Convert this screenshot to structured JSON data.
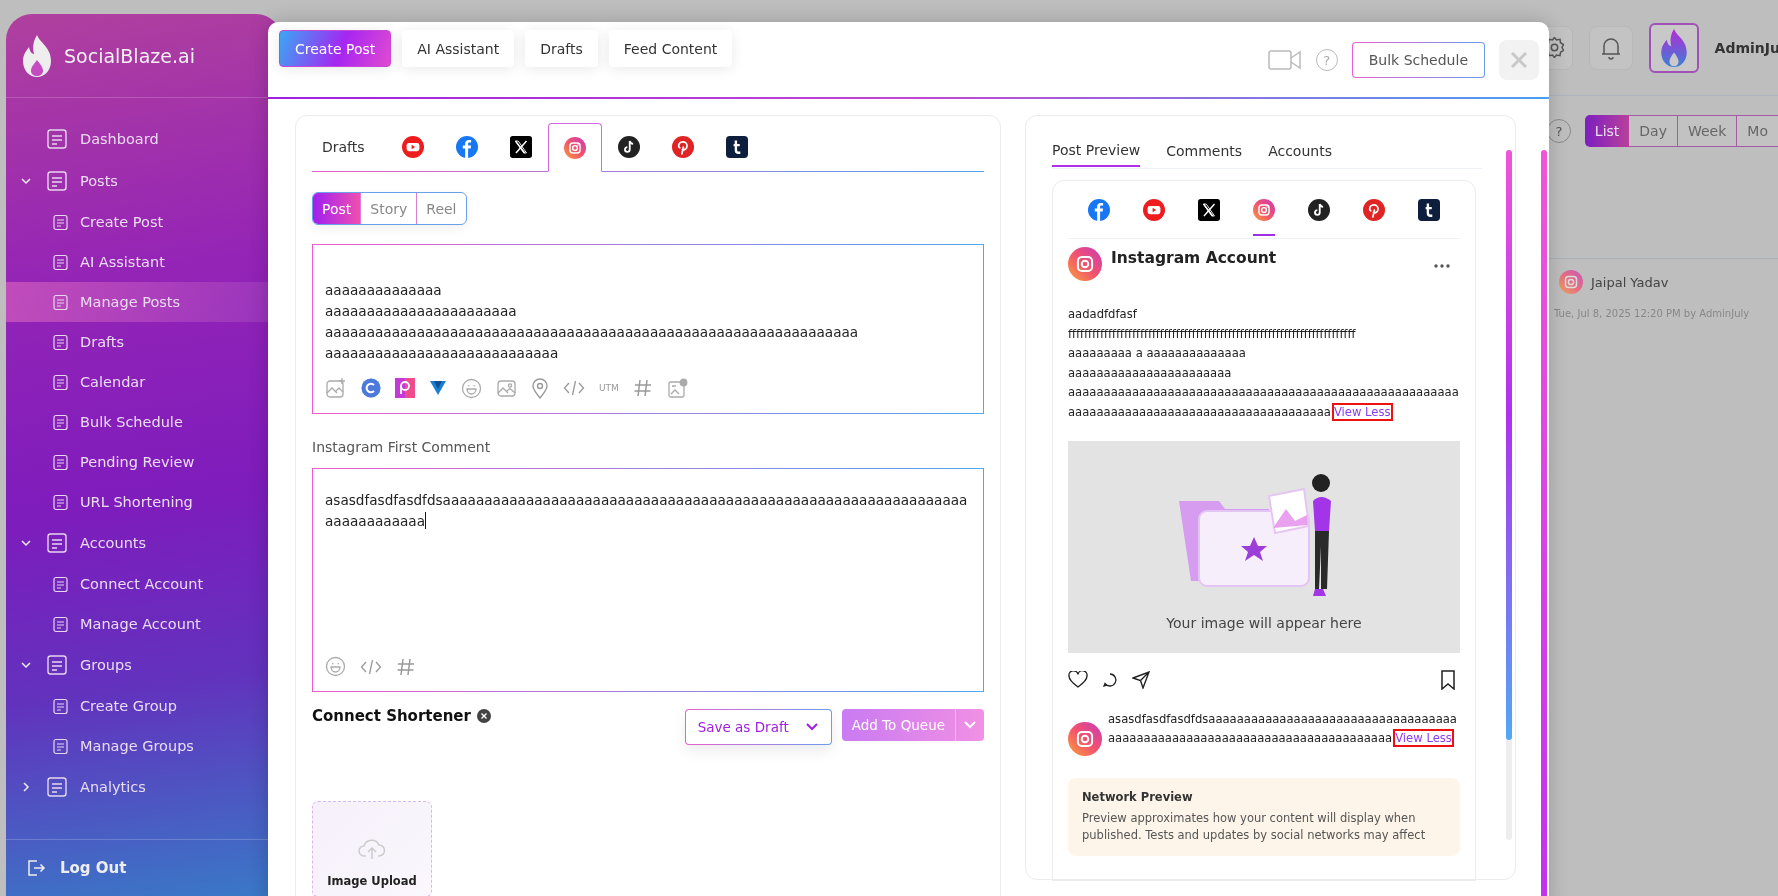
{
  "sidebar": {
    "brand": "SocialBlaze.ai",
    "items": [
      {
        "label": "Dashboard",
        "selected": false
      },
      {
        "label": "Posts",
        "selected": false,
        "expanded": true,
        "children": [
          {
            "label": "Create Post",
            "selected": false
          },
          {
            "label": "AI Assistant",
            "selected": false
          },
          {
            "label": "Manage Posts",
            "selected": true
          },
          {
            "label": "Drafts",
            "selected": false
          },
          {
            "label": "Calendar",
            "selected": false
          },
          {
            "label": "Bulk Schedule",
            "selected": false
          },
          {
            "label": "Pending Review",
            "selected": false
          },
          {
            "label": "URL Shortening",
            "selected": false
          }
        ]
      },
      {
        "label": "Accounts",
        "selected": false,
        "expanded": true,
        "children": [
          {
            "label": "Connect Account",
            "selected": false
          },
          {
            "label": "Manage Account",
            "selected": false
          }
        ]
      },
      {
        "label": "Groups",
        "selected": false,
        "expanded": true,
        "children": [
          {
            "label": "Create Group",
            "selected": false
          },
          {
            "label": "Manage Groups",
            "selected": false
          }
        ]
      },
      {
        "label": "Analytics",
        "selected": false,
        "expanded": false
      }
    ],
    "logout": "Log Out"
  },
  "topbar": {
    "user": "AdminJu",
    "help": "?",
    "views": [
      {
        "label": "List",
        "selected": true
      },
      {
        "label": "Day",
        "selected": false
      },
      {
        "label": "Week",
        "selected": false
      },
      {
        "label": "Mo",
        "selected": false
      }
    ]
  },
  "schedule_entry": {
    "name": "Jaipal Yadav",
    "meta": "Tue, Jul 8, 2025 12:20 PM by AdminJuly"
  },
  "modal": {
    "tabs": [
      {
        "label": "Create Post",
        "selected": true
      },
      {
        "label": "AI Assistant",
        "selected": false
      },
      {
        "label": "Drafts",
        "selected": false
      },
      {
        "label": "Feed Content",
        "selected": false
      }
    ],
    "help": "?",
    "bulk_schedule": "Bulk Schedule"
  },
  "editor": {
    "network_tabs": [
      {
        "kind": "text",
        "label": "Drafts",
        "selected": false
      },
      {
        "kind": "youtube",
        "selected": false
      },
      {
        "kind": "facebook",
        "selected": false
      },
      {
        "kind": "x",
        "selected": false
      },
      {
        "kind": "instagram",
        "selected": true
      },
      {
        "kind": "tiktok",
        "selected": false
      },
      {
        "kind": "pinterest",
        "selected": false
      },
      {
        "kind": "tumblr",
        "selected": false
      }
    ],
    "post_types": [
      {
        "label": "Post",
        "selected": true
      },
      {
        "label": "Story",
        "selected": false
      },
      {
        "label": "Reel",
        "selected": false
      }
    ],
    "caption": "aaaaaaaaaaaaaa\naaaaaaaaaaaaaaaaaaaaaaa\naaaaaaaaaaaaaaaaaaaaaaaaaaaaaaaaaaaaaaaaaaaaaaaaaaaaaaaaaaaaaaaa\naaaaaaaaaaaaaaaaaaaaaaaaaaaa",
    "utm": "UTM",
    "first_comment_label": "Instagram First Comment",
    "first_comment": "asasdfasdfasdfdsaaaaaaaaaaaaaaaaaaaaaaaaaaaaaaaaaaaaaaaaaaaaaaaaaaaaaaaaaaaaaaaaaaaaaaaaaaa",
    "shortener_label": "Connect Shortener",
    "save_draft": "Save as Draft",
    "add_queue": "Add To Queue",
    "upload_label": "Image Upload"
  },
  "preview": {
    "tabs": [
      {
        "label": "Post Preview",
        "selected": true
      },
      {
        "label": "Comments",
        "selected": false
      },
      {
        "label": "Accounts",
        "selected": false
      }
    ],
    "networks": [
      {
        "kind": "facebook",
        "selected": false
      },
      {
        "kind": "youtube",
        "selected": false
      },
      {
        "kind": "x",
        "selected": false
      },
      {
        "kind": "instagram",
        "selected": true
      },
      {
        "kind": "tiktok",
        "selected": false
      },
      {
        "kind": "pinterest",
        "selected": false
      },
      {
        "kind": "tumblr",
        "selected": false
      }
    ],
    "account_name": "Instagram Account",
    "caption": "aadadfdfasf\nffffffffffffffffffffffffffffffffffffffffffffffffffffffffffffffffffffffff\naaaaaaaaa a aaaaaaaaaaaaaa\naaaaaaaaaaaaaaaaaaaaaaa\naaaaaaaaaaaaaaaaaaaaaaaaaaaaaaaaaaaaaaaaaaaaaaaaaaaaaaaaaaaaaaaaaaaaaaaaaaaaaaaaaaaaaaaaaaaa",
    "caption_link": "View Less",
    "image_caption": "Your image will appear here",
    "comment": "asasdfasdfasdfdsaaaaaaaaaaaaaaaaaaaaaaaaaaaaaaaaaaaaaaaaaaaaaaaaaaaaaaaaaaaaaaaaaaaaaaaaaaa",
    "comment_link": "View Less",
    "notice_title": "Network Preview",
    "notice_text": "Preview approximates how your content will display when published. Tests and updates by social networks may affect"
  }
}
